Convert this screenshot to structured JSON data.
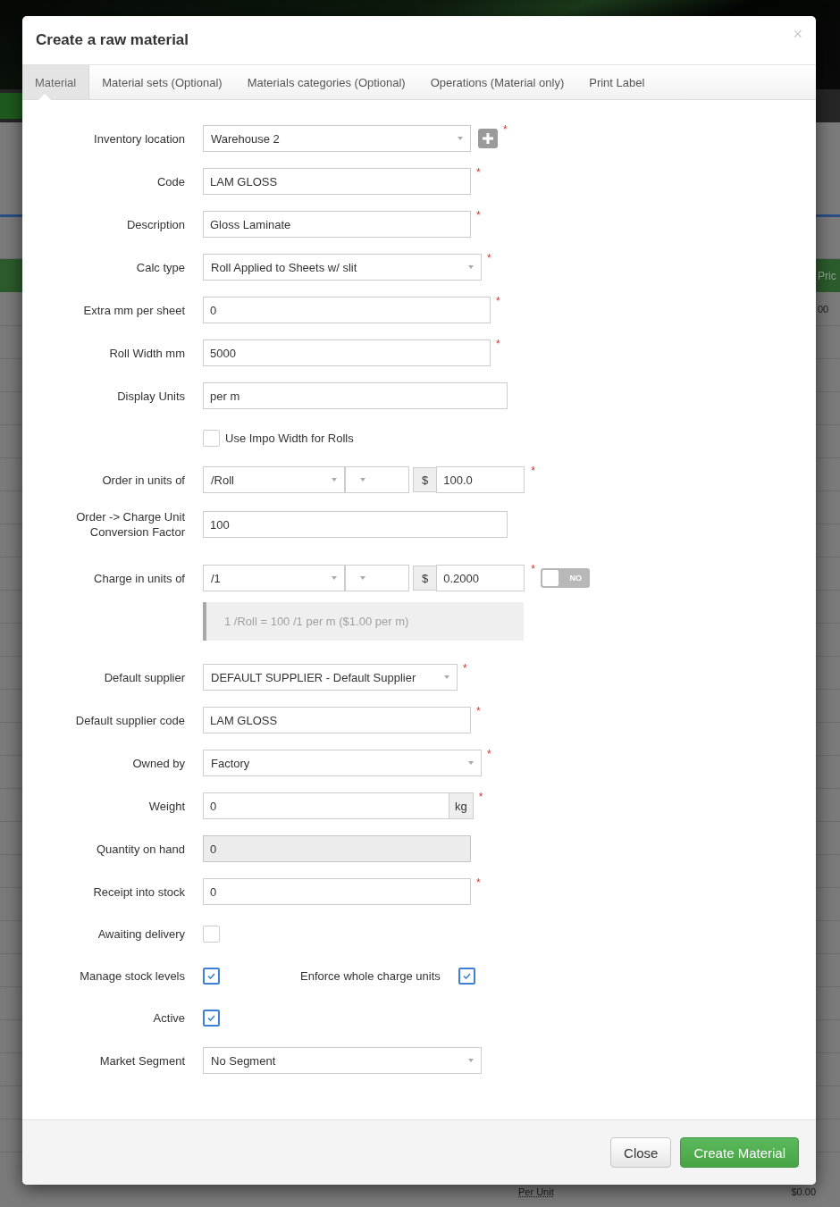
{
  "background": {
    "column_heading": "Pric",
    "cell": "00",
    "footer_label": "Per Unit",
    "footer_value": "$0.00"
  },
  "dialog": {
    "title": "Create a raw material",
    "close": "×"
  },
  "tabs": [
    {
      "label": "Material",
      "selected": true
    },
    {
      "label": "Material sets (Optional)",
      "selected": false
    },
    {
      "label": "Materials categories (Optional)",
      "selected": false
    },
    {
      "label": "Operations (Material only)",
      "selected": false
    },
    {
      "label": "Print Label",
      "selected": false
    }
  ],
  "fields": [
    {
      "kind": "select",
      "label": "Inventory location",
      "value": "Warehouse 2",
      "required_mark": "*",
      "add_button": true
    },
    {
      "kind": "text",
      "label": "Code",
      "value": "LAM GLOSS",
      "required_mark": "*"
    },
    {
      "kind": "text",
      "label": "Description",
      "value": "Gloss Laminate",
      "required_mark": "*"
    },
    {
      "kind": "select",
      "label": "Calc type",
      "value": "Roll Applied to Sheets w/ slit",
      "required_mark": "*"
    },
    {
      "kind": "text",
      "label": "Extra mm per sheet",
      "value": "0",
      "required_mark": "*"
    },
    {
      "kind": "text",
      "label": "Roll Width mm",
      "value": "5000",
      "required_mark": "*"
    },
    {
      "kind": "text",
      "label": "Display Units",
      "value": "per m"
    },
    {
      "kind": "checkbox",
      "text": "Use Impo Width for Rolls",
      "checked": false
    },
    {
      "kind": "unit_price",
      "label": "Order in units of",
      "unit": "/Roll",
      "currency": "$",
      "value": "100.0",
      "required_mark": "*"
    },
    {
      "kind": "text",
      "label": "Order -> Charge Unit Conversion Factor",
      "value": "100"
    },
    {
      "kind": "unit_price",
      "label": "Charge in units of",
      "unit": "/1",
      "currency": "$",
      "value": "0.2000",
      "required_mark": "*",
      "toggle": {
        "text": "NO",
        "on": false
      }
    },
    {
      "kind": "note",
      "text": "1 /Roll = 100 /1 per m ($1.00 per m)"
    },
    {
      "kind": "select",
      "label": "Default supplier",
      "value": "DEFAULT SUPPLIER - Default Supplier",
      "required_mark": "*"
    },
    {
      "kind": "text",
      "label": "Default supplier code",
      "value": "LAM GLOSS",
      "required_mark": "*"
    },
    {
      "kind": "select",
      "label": "Owned by",
      "value": "Factory",
      "required_mark": "*"
    },
    {
      "kind": "text_unit",
      "label": "Weight",
      "value": "0",
      "unit": "kg",
      "required_mark": "*"
    },
    {
      "kind": "text",
      "label": "Quantity on hand",
      "value": "0",
      "disabled": true
    },
    {
      "kind": "text",
      "label": "Receipt into stock",
      "value": "0",
      "required_mark": "*"
    },
    {
      "kind": "checkbox_field",
      "label": "Awaiting delivery",
      "checked": false
    },
    {
      "kind": "checkbox_field",
      "label": "Manage stock levels",
      "checked": true,
      "extra": {
        "label": "Enforce whole charge units",
        "checked": true
      }
    },
    {
      "kind": "checkbox_field",
      "label": "Active",
      "checked": true
    },
    {
      "kind": "select",
      "label": "Market Segment",
      "value": "No Segment"
    }
  ],
  "buttons": [
    {
      "label": "Close",
      "kind": "default"
    },
    {
      "label": "Create Material",
      "kind": "primary"
    }
  ]
}
